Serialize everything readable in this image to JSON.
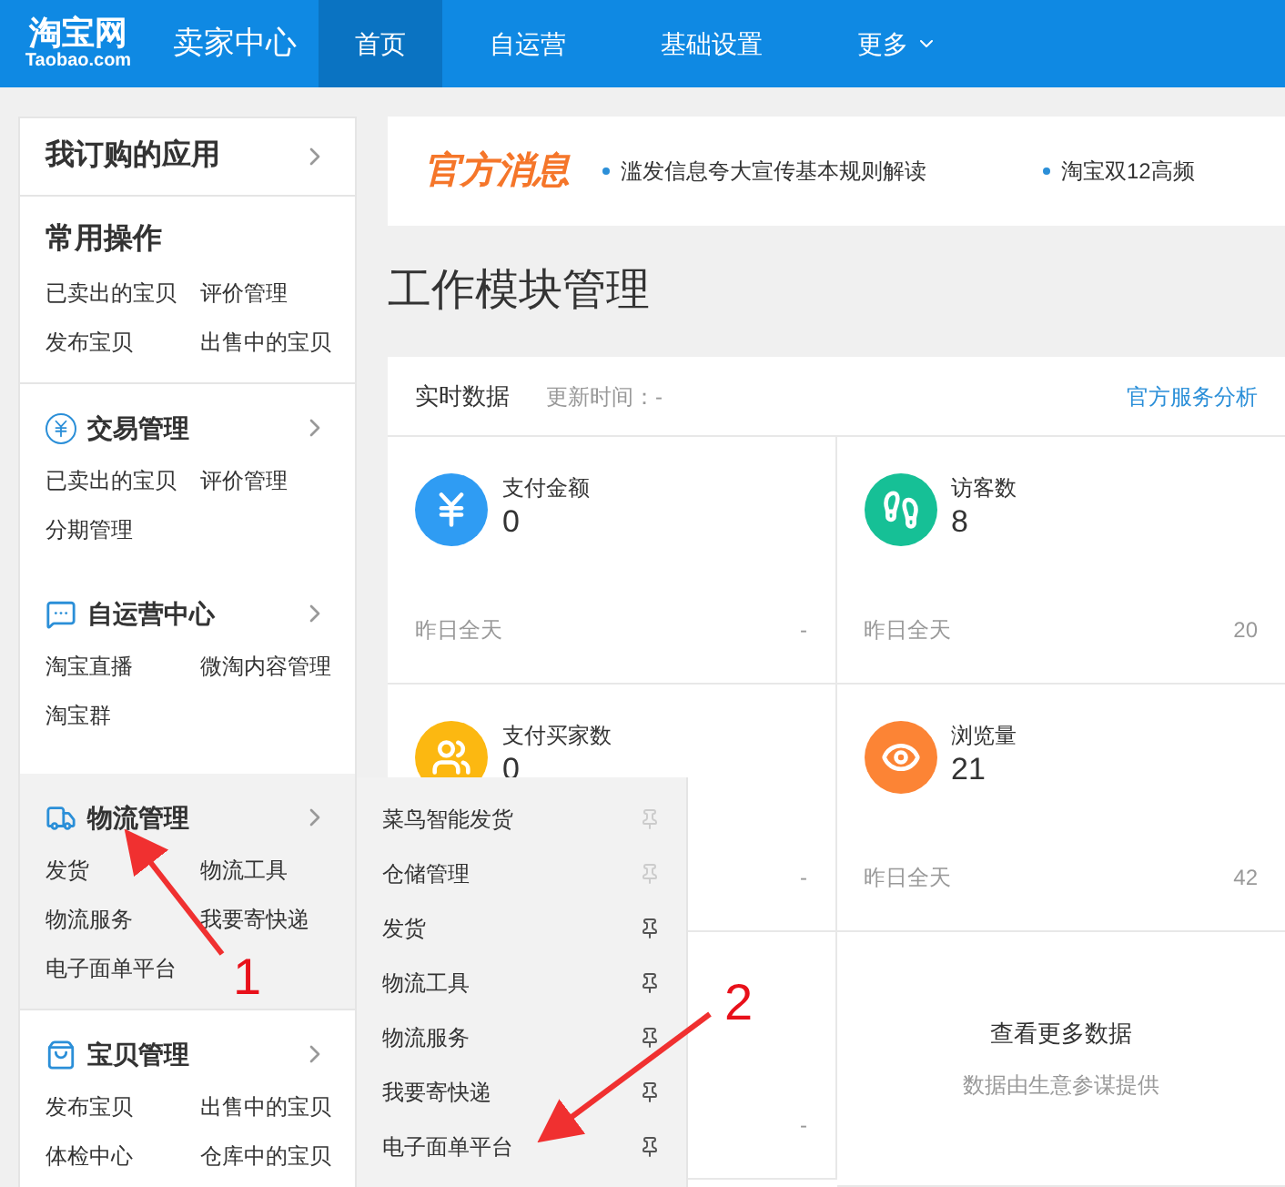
{
  "header": {
    "logo": "淘宝网",
    "logo_sub": "Taobao.com",
    "title": "卖家中心",
    "nav": [
      {
        "label": "首页",
        "selected": true,
        "kind": "link"
      },
      {
        "label": "自运营",
        "selected": false,
        "kind": "link"
      },
      {
        "label": "基础设置",
        "selected": false,
        "kind": "link"
      },
      {
        "label": "更多",
        "selected": false,
        "kind": "dropdown"
      }
    ]
  },
  "sidebar": {
    "sections": [
      {
        "kind": "header",
        "title": "我订购的应用",
        "selected": false
      },
      {
        "kind": "plain",
        "title": "常用操作",
        "selected": false,
        "links": [
          "已卖出的宝贝",
          "评价管理",
          "发布宝贝",
          "出售中的宝贝"
        ]
      },
      {
        "kind": "group",
        "title": "交易管理",
        "selected": false,
        "links": [
          "已卖出的宝贝",
          "评价管理",
          "分期管理"
        ]
      },
      {
        "kind": "group",
        "title": "自运营中心",
        "selected": false,
        "links": [
          "淘宝直播",
          "微淘内容管理",
          "淘宝群"
        ]
      },
      {
        "kind": "group",
        "title": "物流管理",
        "selected": true,
        "links": [
          "发货",
          "物流工具",
          "物流服务",
          "我要寄快递",
          "电子面单平台"
        ]
      },
      {
        "kind": "group",
        "title": "宝贝管理",
        "selected": false,
        "links": [
          "发布宝贝",
          "出售中的宝贝",
          "体检中心",
          "仓库中的宝贝"
        ]
      }
    ]
  },
  "banner": {
    "title": "官方消息",
    "news": [
      "滥发信息夸大宣传基本规则解读",
      "淘宝双12高频"
    ]
  },
  "page_title": "工作模块管理",
  "realtime": {
    "title": "实时数据",
    "updated": "更新时间：-",
    "link": "官方服务分析",
    "stats": [
      {
        "kind": "stat",
        "label": "支付金额",
        "value": "0",
        "footer": "昨日全天",
        "compare": "-"
      },
      {
        "kind": "stat",
        "label": "访客数",
        "value": "8",
        "footer": "昨日全天",
        "compare": "20"
      },
      {
        "kind": "stat",
        "label": "支付买家数",
        "value": "0",
        "compare": "-"
      },
      {
        "kind": "stat",
        "label": "浏览量",
        "value": "21",
        "footer": "昨日全天",
        "compare": "42"
      },
      {
        "kind": "stat",
        "compare": "-"
      },
      {
        "kind": "more",
        "label": "查看更多数据",
        "note": "数据由生意参谋提供"
      }
    ]
  },
  "flyout": {
    "items": [
      {
        "label": "菜鸟智能发货",
        "pinned": false
      },
      {
        "label": "仓储管理",
        "pinned": false
      },
      {
        "label": "发货",
        "pinned": true
      },
      {
        "label": "物流工具",
        "pinned": true
      },
      {
        "label": "物流服务",
        "pinned": true
      },
      {
        "label": "我要寄快递",
        "pinned": true
      },
      {
        "label": "电子面单平台",
        "pinned": true
      }
    ]
  },
  "annotations": [
    {
      "label": "1"
    },
    {
      "label": "2"
    }
  ]
}
